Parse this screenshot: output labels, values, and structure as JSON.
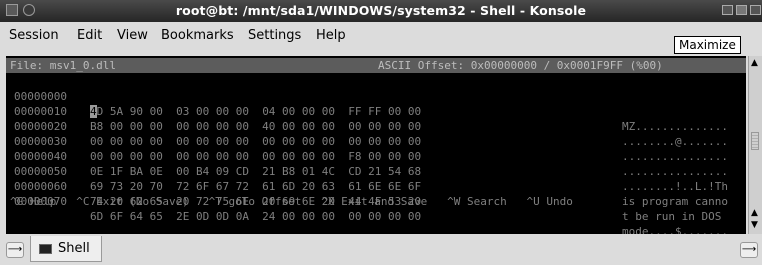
{
  "window": {
    "title": "root@bt: /mnt/sda1/WINDOWS/system32 - Shell - Konsole",
    "tooltip": "Maximize"
  },
  "menubar": {
    "items": [
      "Session",
      "Edit",
      "View",
      "Bookmarks",
      "Settings",
      "Help"
    ]
  },
  "editor": {
    "file_label": "File: msv1_0.dll",
    "status_right": "ASCII Offset: 0x00000000 / 0x0001F9FF (%00)",
    "rows": [
      {
        "addr": "00000000",
        "cursor": "4",
        "hex": "D 5A 90 00  03 00 00 00  04 00 00 00  FF FF 00 00",
        "ascii": "MZ.............."
      },
      {
        "addr": "00000010",
        "hex": "B8 00 00 00  00 00 00 00  40 00 00 00  00 00 00 00",
        "ascii": "........@......."
      },
      {
        "addr": "00000020",
        "hex": "00 00 00 00  00 00 00 00  00 00 00 00  00 00 00 00",
        "ascii": "................"
      },
      {
        "addr": "00000030",
        "hex": "00 00 00 00  00 00 00 00  00 00 00 00  F8 00 00 00",
        "ascii": "................"
      },
      {
        "addr": "00000040",
        "hex": "0E 1F BA 0E  00 B4 09 CD  21 B8 01 4C  CD 21 54 68",
        "ascii": "........!..L.!Th"
      },
      {
        "addr": "00000050",
        "hex": "69 73 20 70  72 6F 67 72  61 6D 20 63  61 6E 6E 6F",
        "ascii": "is program canno"
      },
      {
        "addr": "00000060",
        "hex": "74 20 62 65  20 72 75 6E  20 69 6E 20  44 4F 53 20",
        "ascii": "t be run in DOS "
      },
      {
        "addr": "00000070",
        "hex": "6D 6F 64 65  2E 0D 0D 0A  24 00 00 00  00 00 00 00",
        "ascii": "mode....$......."
      }
    ],
    "help_bar": "^G Help   ^C Exit (No Save)   ^T goTo Offset   ^X Exit and Save   ^W Search   ^U Undo"
  },
  "tabs": {
    "active": "Shell"
  },
  "icons": [
    "window-menu-icon",
    "sticky-icon",
    "minimize-icon",
    "maximize-icon",
    "close-icon",
    "scroll-up-icon",
    "scroll-down-icon",
    "new-tab-icon",
    "terminal-icon",
    "close-tab-icon"
  ]
}
